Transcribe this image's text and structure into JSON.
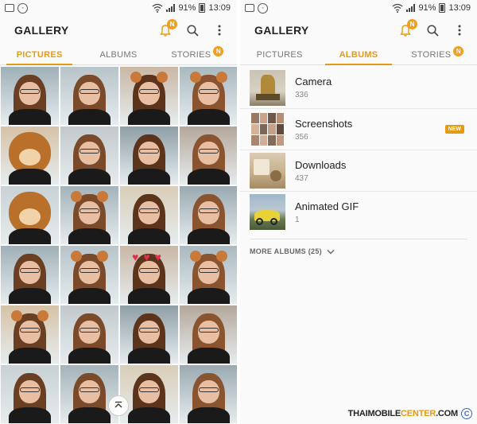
{
  "left": {
    "status": {
      "time": "13:09",
      "battery": "91%"
    },
    "app_title": "GALLERY",
    "notification_badge": "N",
    "tabs": [
      {
        "label": "PICTURES",
        "active": true
      },
      {
        "label": "ALBUMS",
        "active": false
      },
      {
        "label": "STORIES",
        "active": false,
        "badge": "N"
      }
    ]
  },
  "right": {
    "status": {
      "time": "13:09",
      "battery": "91%"
    },
    "app_title": "GALLERY",
    "notification_badge": "N",
    "tabs": [
      {
        "label": "PICTURES",
        "active": false
      },
      {
        "label": "ALBUMS",
        "active": true
      },
      {
        "label": "STORIES",
        "active": false,
        "badge": "N"
      }
    ],
    "albums": [
      {
        "name": "Camera",
        "count": "336"
      },
      {
        "name": "Screenshots",
        "count": "356",
        "badge": "NEW"
      },
      {
        "name": "Downloads",
        "count": "437"
      },
      {
        "name": "Animated GIF",
        "count": "1"
      }
    ],
    "more_albums": "MORE ALBUMS (25)"
  },
  "watermark": {
    "part1": "THAIMOBILE",
    "part2": "CENTER",
    "part3": ".COM",
    "symbol": "C"
  },
  "colors": {
    "accent": "#e69a14",
    "badge": "#f0a020"
  }
}
